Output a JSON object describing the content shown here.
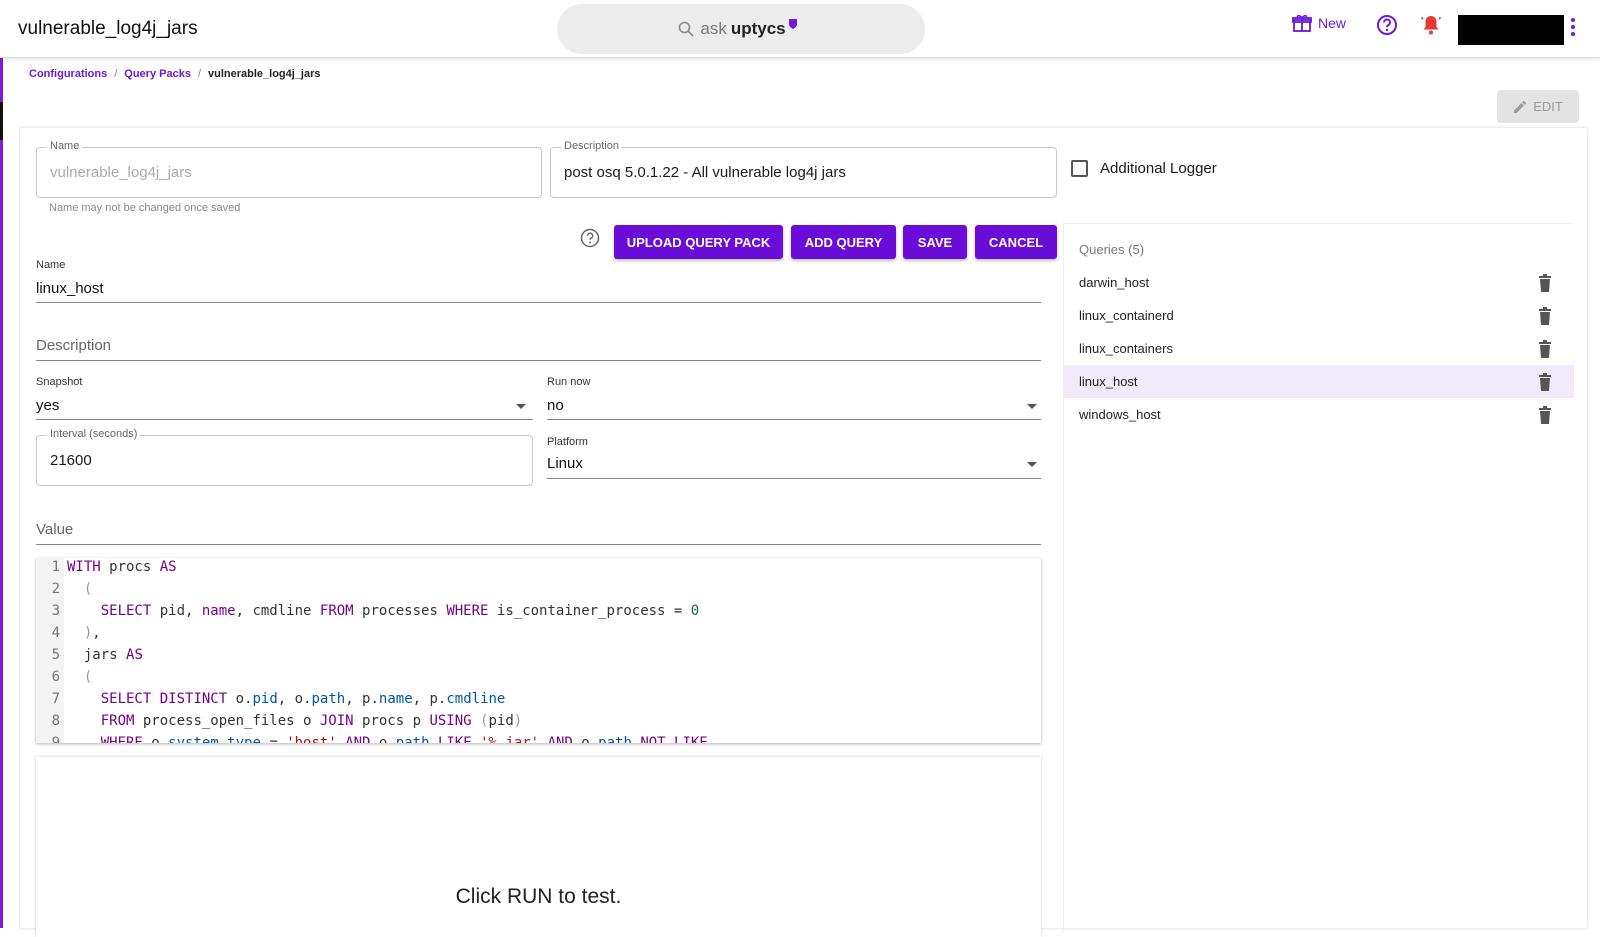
{
  "app": {
    "title": "vulnerable_log4j_jars",
    "search_prefix": "ask",
    "search_brand": "uptycs",
    "new_label": "New",
    "accent": "#6a0dd8"
  },
  "breadcrumb": [
    "Configurations",
    "Query Packs",
    "vulnerable_log4j_jars"
  ],
  "edit_label": "EDIT",
  "pack": {
    "name_label": "Name",
    "name_value": "vulnerable_log4j_jars",
    "name_helper": "Name may not be changed once saved",
    "description_label": "Description",
    "description_value": "post osq 5.0.1.22 - All vulnerable log4j jars",
    "additional_logger_label": "Additional Logger"
  },
  "buttons": {
    "upload": "UPLOAD QUERY PACK",
    "add": "ADD QUERY",
    "save": "SAVE",
    "cancel": "CANCEL"
  },
  "query": {
    "name_label": "Name",
    "name_value": "linux_host",
    "description_placeholder": "Description",
    "snapshot_label": "Snapshot",
    "snapshot_value": "yes",
    "runnow_label": "Run now",
    "runnow_value": "no",
    "interval_label": "Interval (seconds)",
    "interval_value": "21600",
    "platform_label": "Platform",
    "platform_value": "Linux",
    "value_placeholder": "Value"
  },
  "code_lines": [
    "WITH procs AS",
    "  (",
    "    SELECT pid, name, cmdline FROM processes WHERE is_container_process = 0",
    "  ),",
    "  jars AS",
    "  (",
    "    SELECT DISTINCT o.pid, o.path, p.name, p.cmdline",
    "    FROM process_open_files o JOIN procs p USING (pid)",
    "    WHERE o.system_type = 'host' AND o.path LIKE '%.jar' AND o.path NOT LIKE"
  ],
  "results_hint": "Click RUN to test.",
  "queries": {
    "title": "Queries (5)",
    "items": [
      "darwin_host",
      "linux_containerd",
      "linux_containers",
      "linux_host",
      "windows_host"
    ],
    "selected_index": 3
  }
}
